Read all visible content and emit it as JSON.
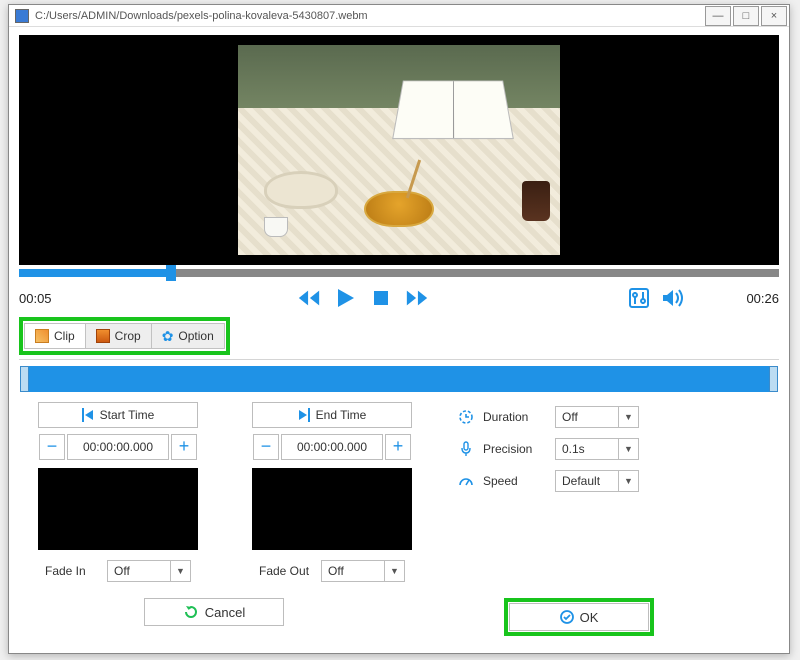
{
  "window": {
    "title": "C:/Users/ADMIN/Downloads/pexels-polina-kovaleva-5430807.webm"
  },
  "transport": {
    "current_time": "00:05",
    "total_time": "00:26"
  },
  "tabs": {
    "clip": "Clip",
    "crop": "Crop",
    "option": "Option"
  },
  "editor": {
    "start_btn": "Start Time",
    "end_btn": "End Time",
    "start_tc": "00:00:00.000",
    "end_tc": "00:00:00.000",
    "fade_in_label": "Fade In",
    "fade_out_label": "Fade Out",
    "fade_in_value": "Off",
    "fade_out_value": "Off"
  },
  "options": {
    "duration_label": "Duration",
    "duration_value": "Off",
    "precision_label": "Precision",
    "precision_value": "0.1s",
    "speed_label": "Speed",
    "speed_value": "Default"
  },
  "footer": {
    "cancel": "Cancel",
    "ok": "OK"
  }
}
